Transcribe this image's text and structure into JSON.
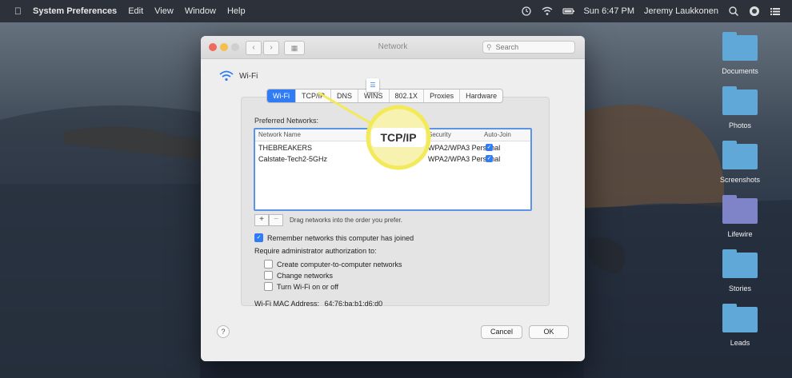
{
  "menubar": {
    "app": "System Preferences",
    "menus": [
      "Edit",
      "View",
      "Window",
      "Help"
    ],
    "clock": "Sun 6:47 PM",
    "user": "Jeremy Laukkonen"
  },
  "desktop": {
    "items": [
      {
        "label": "Documents",
        "color": "#5fa8d8"
      },
      {
        "label": "Photos",
        "color": "#5fa8d8"
      },
      {
        "label": "Screenshots",
        "color": "#5fa8d8"
      },
      {
        "label": "Lifewire",
        "color": "#7f84c8"
      },
      {
        "label": "Stories",
        "color": "#5fa8d8"
      },
      {
        "label": "Leads",
        "color": "#5fa8d8"
      }
    ]
  },
  "window": {
    "title": "Network",
    "search_placeholder": "Search",
    "interface": "Wi-Fi",
    "tabs": [
      "Wi-Fi",
      "TCP/IP",
      "DNS",
      "WINS",
      "802.1X",
      "Proxies",
      "Hardware"
    ],
    "active_tab": "Wi-Fi",
    "preferred_label": "Preferred Networks:",
    "columns": {
      "name": "Network Name",
      "security": "Security",
      "auto_join": "Auto-Join"
    },
    "networks": [
      {
        "name": "THEBREAKERS",
        "security": "WPA2/WPA3 Personal",
        "auto_join": true
      },
      {
        "name": "Calstate-Tech2-5GHz",
        "security": "WPA2/WPA3 Personal",
        "auto_join": true
      }
    ],
    "add_label": "+",
    "remove_label": "−",
    "drag_hint": "Drag networks into the order you prefer.",
    "remember_label": "Remember networks this computer has joined",
    "remember_checked": true,
    "require_label": "Require administrator authorization to:",
    "auth_options": [
      {
        "label": "Create computer-to-computer networks",
        "checked": false
      },
      {
        "label": "Change networks",
        "checked": false
      },
      {
        "label": "Turn Wi-Fi on or off",
        "checked": false
      }
    ],
    "mac_label": "Wi-Fi MAC Address:",
    "mac_value": "64:76:ba:b1:d6:d0",
    "help_label": "?",
    "cancel_label": "Cancel",
    "ok_label": "OK"
  },
  "callout": {
    "label": "TCP/IP",
    "color": "#f2ea5a"
  }
}
